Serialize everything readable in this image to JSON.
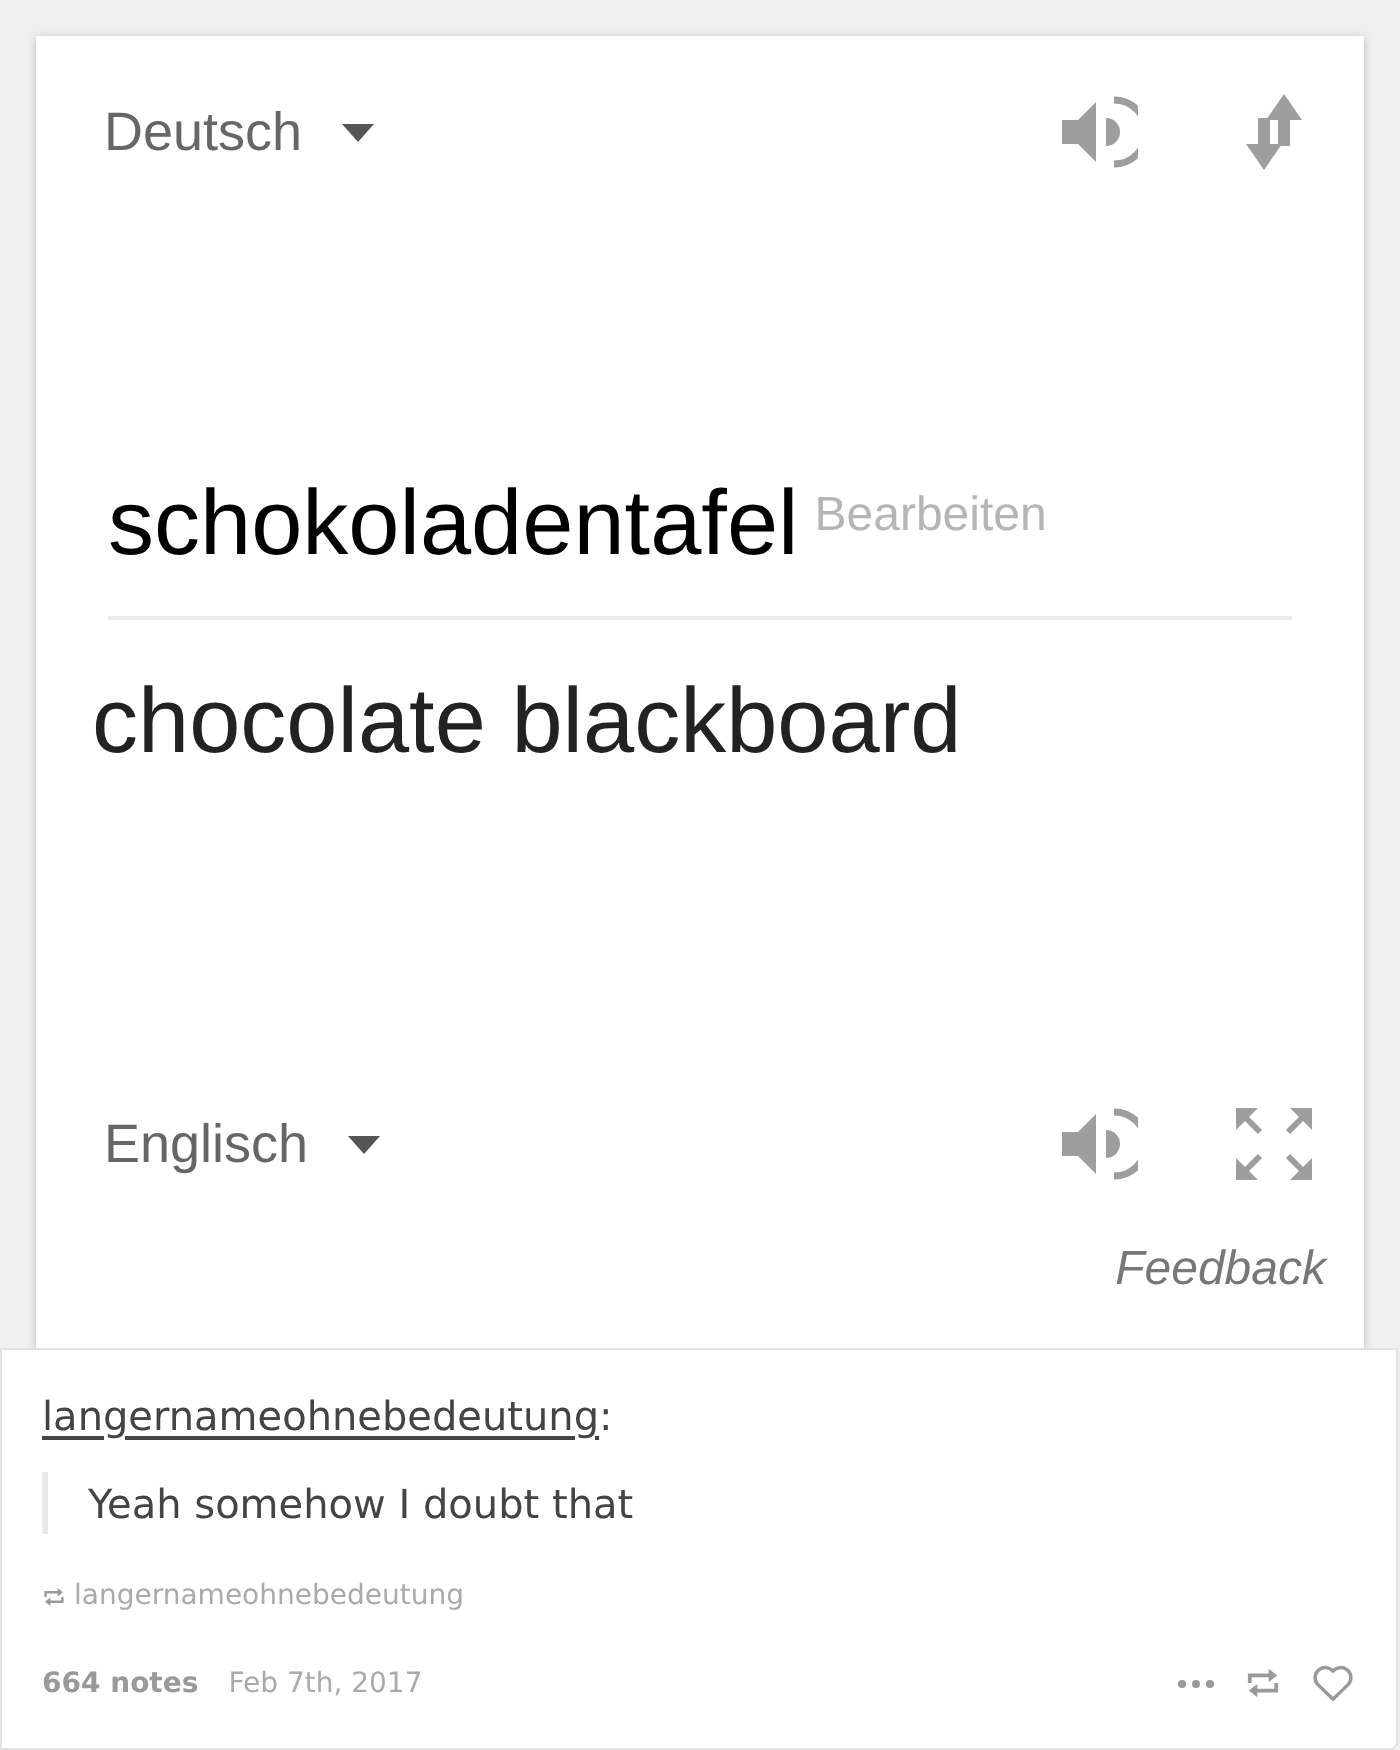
{
  "translator": {
    "source_language": "Deutsch",
    "source_text": "schokoladentafel",
    "edit_link": "Bearbeiten",
    "translation": "chocolate blackboard",
    "target_language": "Englisch",
    "feedback_link": "Feedback"
  },
  "post": {
    "author": "langernameohnebedeutung",
    "author_suffix": ":",
    "quote": "Yeah somehow I doubt that",
    "reblogged_from": "langernameohnebedeutung",
    "notes": "664 notes",
    "date": "Feb 7th, 2017"
  }
}
